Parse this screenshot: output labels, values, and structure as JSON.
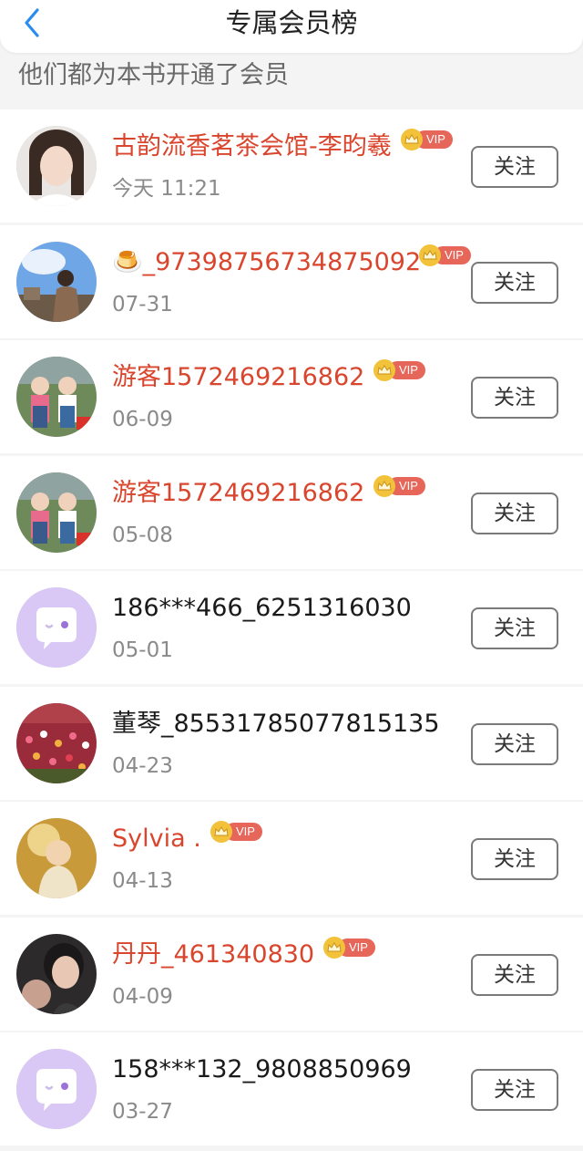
{
  "header": {
    "title": "专属会员榜",
    "back_icon": "chevron-left-icon"
  },
  "subtitle": "他们都为本书开通了会员",
  "follow_label": "关注",
  "vip_label": "VIP",
  "members": [
    {
      "name": "古韵流香茗茶会馆-李昀羲",
      "date": "今天 11:21",
      "vip": true
    },
    {
      "name": "_97398756734875092",
      "date": "07-31",
      "vip": true,
      "emoji": "🍮"
    },
    {
      "name": "游客1572469216862",
      "date": "06-09",
      "vip": true
    },
    {
      "name": "游客1572469216862",
      "date": "05-08",
      "vip": true
    },
    {
      "name": "186***466_6251316030",
      "date": "05-01",
      "vip": false
    },
    {
      "name": "董琴_85531785077815135",
      "date": "04-23",
      "vip": false
    },
    {
      "name": "Sylvia .",
      "date": "04-13",
      "vip": true
    },
    {
      "name": "丹丹_461340830",
      "date": "04-09",
      "vip": true
    },
    {
      "name": "158***132_9808850969",
      "date": "03-27",
      "vip": false
    }
  ],
  "colors": {
    "vip_name": "#d9452d",
    "vip_tag": "#e6665a",
    "crown": "#f2c23a",
    "accent_back": "#2a8cf0"
  }
}
